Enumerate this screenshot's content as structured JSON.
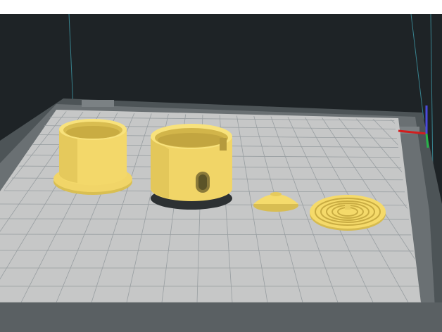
{
  "viewport": {
    "description_free": true,
    "background_color": "#1e2326",
    "top_strip_color": "#ffffff",
    "bed_color": "#c9c9c9",
    "grid_color": "#8f9598",
    "frame_color": "#5d6366",
    "build_volume_edge_color": "#4fb6c6",
    "model_color": "#f7dc6f",
    "axis_colors": {
      "x": "#d21e1e",
      "y": "#27b44a",
      "z": "#4b4bde"
    }
  },
  "objects": [
    {
      "icon": "cylinder-cup-icon"
    },
    {
      "icon": "slotted-ring-icon"
    },
    {
      "icon": "dome-cap-icon"
    },
    {
      "icon": "spiral-disc-icon"
    }
  ],
  "gizmo": {
    "icon": "xyz-axis-icon"
  }
}
